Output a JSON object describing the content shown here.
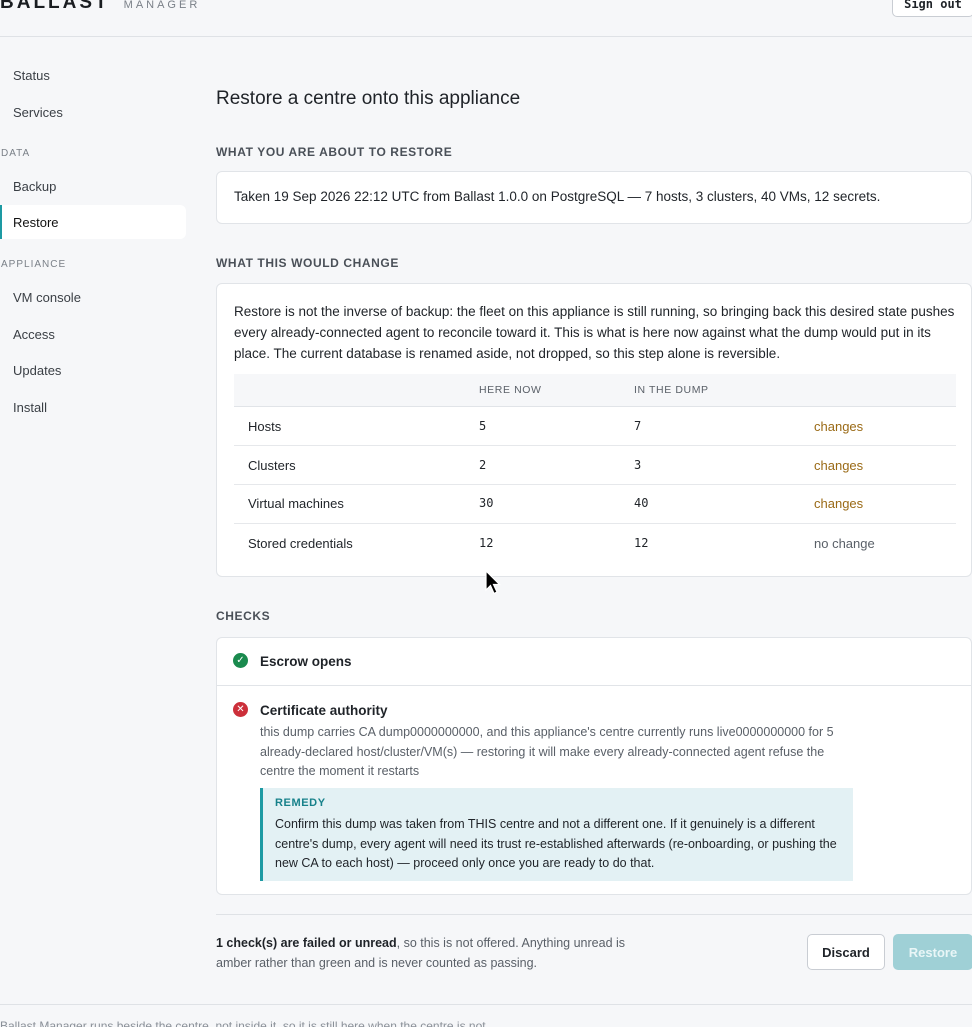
{
  "header": {
    "brand": "BALLAST",
    "brand_sub": "MANAGER",
    "signout_label": "Sign out"
  },
  "sidebar": {
    "items_top": [
      {
        "label": "Status"
      },
      {
        "label": "Services"
      }
    ],
    "section_data": "DATA",
    "items_data": [
      {
        "label": "Backup"
      },
      {
        "label": "Restore",
        "active": true
      }
    ],
    "section_appliance": "APPLIANCE",
    "items_appliance": [
      {
        "label": "VM console"
      },
      {
        "label": "Access"
      },
      {
        "label": "Updates"
      },
      {
        "label": "Install"
      }
    ]
  },
  "main": {
    "title": "Restore a centre onto this appliance",
    "about_label": "WHAT YOU ARE ABOUT TO RESTORE",
    "about_text": "Taken 19 Sep 2026 22:12 UTC from Ballast 1.0.0 on PostgreSQL — 7 hosts, 3 clusters, 40 VMs, 12 secrets.",
    "change_label": "WHAT THIS WOULD CHANGE",
    "change_explain": "Restore is not the inverse of backup: the fleet on this appliance is still running, so bringing back this desired state pushes every already-connected agent to reconcile toward it. This is what is here now against what the dump would put in its place. The current database is renamed aside, not dropped, so this step alone is reversible.",
    "table": {
      "headers": [
        "",
        "HERE NOW",
        "IN THE DUMP",
        ""
      ],
      "rows": [
        {
          "name": "Hosts",
          "now": "5",
          "dump": "7",
          "status": "changes"
        },
        {
          "name": "Clusters",
          "now": "2",
          "dump": "3",
          "status": "changes"
        },
        {
          "name": "Virtual machines",
          "now": "30",
          "dump": "40",
          "status": "changes"
        },
        {
          "name": "Stored credentials",
          "now": "12",
          "dump": "12",
          "status": "no change"
        }
      ]
    },
    "checks_label": "CHECKS",
    "checks": [
      {
        "title": "Escrow opens",
        "status": "ok"
      },
      {
        "title": "Certificate authority",
        "status": "fail",
        "desc": "this dump carries CA dump0000000000, and this appliance's centre currently runs live0000000000 for 5 already-declared host/cluster/VM(s) — restoring it will make every already-connected agent refuse the centre the moment it restarts",
        "remedy_title": "REMEDY",
        "remedy_text": "Confirm this dump was taken from THIS centre and not a different one. If it genuinely is a different centre's dump, every agent will need its trust re-established afterwards (re-onboarding, or pushing the new CA to each host) — proceed only once you are ready to do that."
      }
    ],
    "footer": {
      "note_bold": "1 check(s) are failed or unread",
      "note_rest": ", so this is not offered. Anything unread is amber rather than green and is never counted as passing.",
      "discard_label": "Discard",
      "restore_label": "Restore"
    }
  },
  "bottom_text": "Ballast Manager runs beside the centre, not inside it, so it is still here when the centre is not.",
  "colors": {
    "accent": "#1d9aa3",
    "changes": "#9a6a16",
    "ok": "#1a8a4e",
    "fail": "#cc2f3a"
  },
  "icons": [
    "check-circle-icon",
    "x-circle-icon",
    "mouse-cursor-icon"
  ]
}
